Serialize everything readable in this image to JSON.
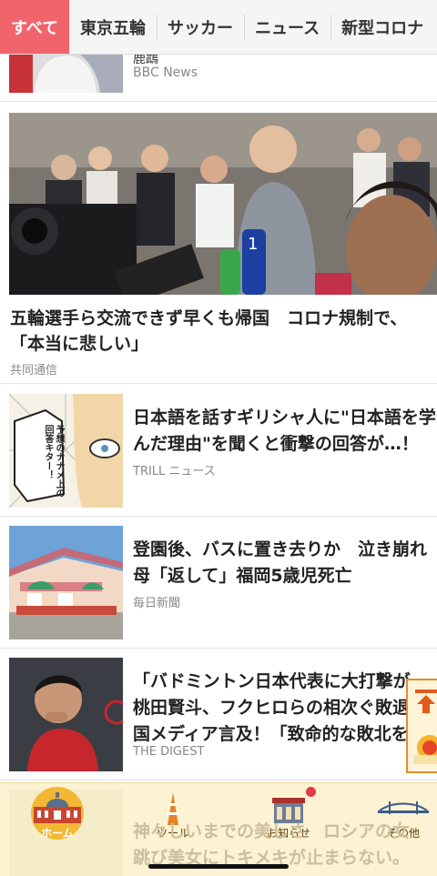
{
  "tabs": [
    {
      "label": "すべて",
      "active": true
    },
    {
      "label": "東京五輪"
    },
    {
      "label": "サッカー"
    },
    {
      "label": "ニュース"
    },
    {
      "label": "新型コロナ"
    }
  ],
  "articles": {
    "partial": {
      "title_fragment": "鹿鵡",
      "source": "BBC News"
    },
    "hero": {
      "title": "五輪選手ら交流できず早くも帰国　コロナ規制で、「本当に悲しい」",
      "source": "共同通信"
    },
    "list": [
      {
        "title_line1": "日本語を話すギリシャ人に\"日本語を学",
        "title_line2": "んだ理由\"を聞くと衝撃の回答が…！",
        "source": "TRILL ニュース",
        "thumb_caption": "予想のナナメ上の回答キター！"
      },
      {
        "title_line1": "登園後、バスに置き去りか　泣き崩れ",
        "title_line2": "母「返して」福岡5歳児死亡",
        "source": "毎日新聞"
      },
      {
        "title_line1": "「バドミントン日本代表に大打撃が",
        "title_line2": "桃田賢斗、フクヒロらの相次ぐ敗退",
        "title_line3": "国メディア言及！「致命的な敗北を",
        "source": "THE DIGEST"
      },
      {
        "title_line1": "神々しいまでの美しさ　ロシアの女",
        "title_line2": "跳び美女にトキメキが止まらない。"
      }
    ]
  },
  "bottom_nav": [
    {
      "label": "ホーム",
      "icon": "station-icon",
      "active": true
    },
    {
      "label": "ツール",
      "icon": "tower-icon"
    },
    {
      "label": "お知らせ",
      "icon": "shop-icon",
      "badge": true
    },
    {
      "label": "その他",
      "icon": "bridge-icon"
    }
  ],
  "colors": {
    "accent": "#f2646c",
    "nav_bg": "#fdf1cd",
    "active_pill": "#f2b733",
    "badge": "#e5394a"
  }
}
